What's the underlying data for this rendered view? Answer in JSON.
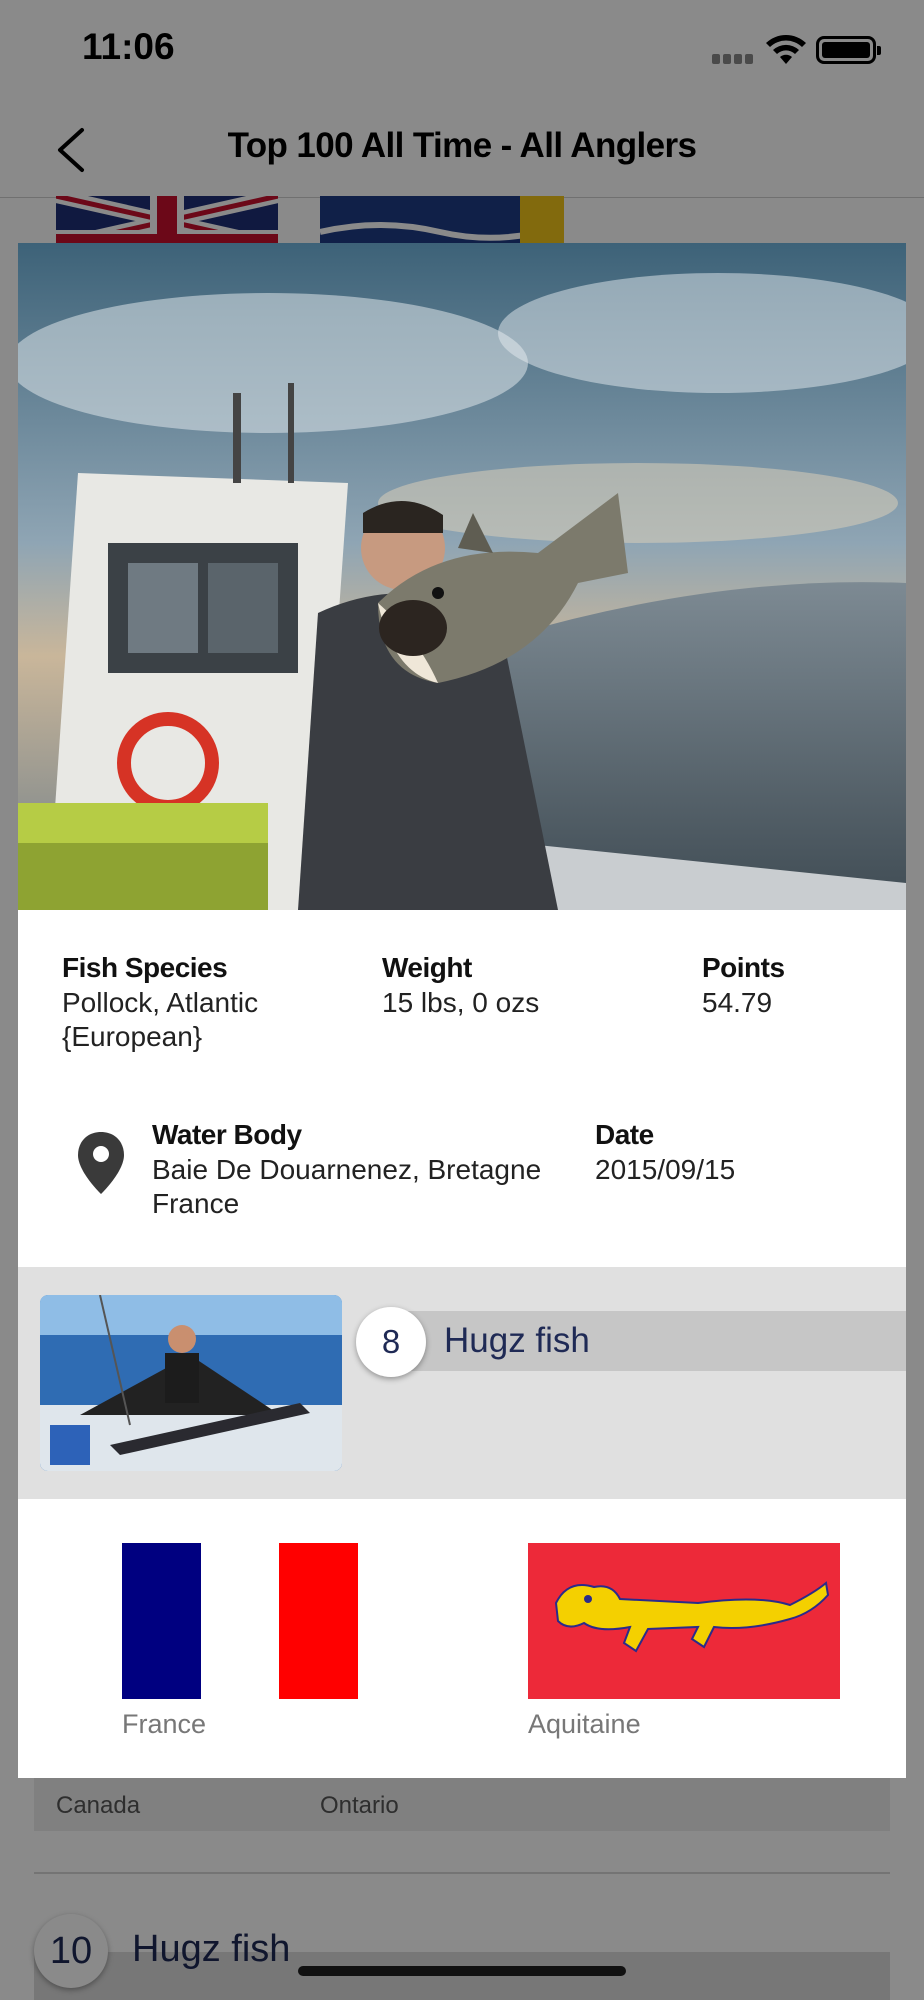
{
  "status_bar": {
    "time": "11:06"
  },
  "navbar": {
    "title": "Top 100 All Time - All Anglers",
    "back_icon": "chevron-left-icon"
  },
  "background_list": {
    "country": "Canada",
    "region": "Ontario",
    "next_rank": "10",
    "next_angler": "Hugz fish"
  },
  "catch": {
    "fish_species_label": "Fish Species",
    "fish_species_value": "Pollock, Atlantic {European}",
    "weight_label": "Weight",
    "weight_value": "15 lbs, 0 ozs",
    "points_label": "Points",
    "points_value": "54.79",
    "water_body_label": "Water Body",
    "water_body_value_line1": "Baie De Douarnenez, Bretagne",
    "water_body_value_line2": "France",
    "date_label": "Date",
    "date_value": "2015/09/15",
    "location_icon": "map-pin-icon"
  },
  "angler": {
    "rank": "8",
    "name": "Hugz fish"
  },
  "flags": {
    "country_label": "France",
    "region_label": "Aquitaine"
  },
  "colors": {
    "navy_text": "#1f2a55",
    "france_blue": "#000080",
    "france_red": "#ff0000",
    "aquitaine_red": "#ed2939",
    "aquitaine_gold": "#f4d000"
  }
}
